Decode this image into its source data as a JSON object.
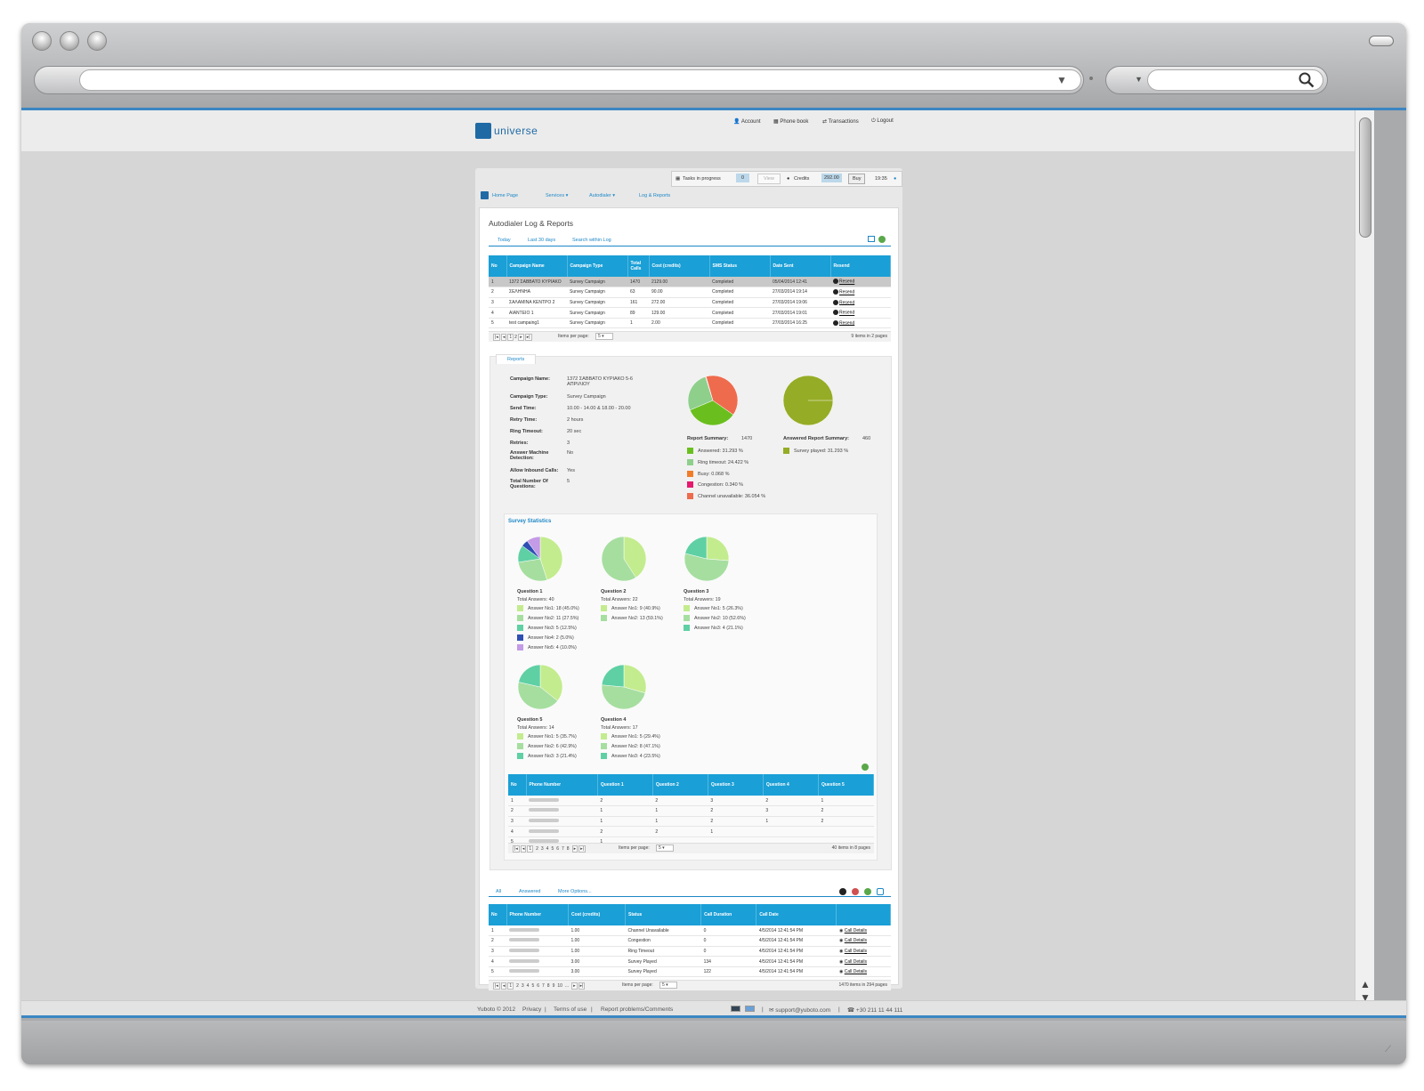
{
  "header": {
    "logo_text": "universe",
    "nav": [
      "Account",
      "Phone book",
      "Transactions",
      "Logout"
    ]
  },
  "statusbar": {
    "tasks_label": "Tasks in progress",
    "tasks_count": "0",
    "view_label": "View",
    "credits_label": "Credits",
    "credits_value": "292.00",
    "buy_label": "Buy",
    "time": "19:35"
  },
  "breadcrumbs": [
    "Home Page",
    "Services ▾",
    "Autodialer ▾",
    "Log & Reports"
  ],
  "page": {
    "title": "Autodialer Log & Reports",
    "tabs": [
      "Today",
      "Last 30 days",
      "Search within Log"
    ]
  },
  "campaigns": {
    "columns": [
      "No",
      "Campaign Name",
      "Campaign Type",
      "Total Calls",
      "Cost (credits)",
      "SMS Status",
      "Date Sent",
      "Resend"
    ],
    "rows": [
      [
        "1",
        "1372 ΣΑΒΒΑΤΟ ΚΥΡΙΑΚΟ",
        "Survey Campaign",
        "1470",
        "2129.00",
        "Completed",
        "05/04/2014 12:41",
        "Resend"
      ],
      [
        "2",
        "ΣΕΛΗΝΗΑ",
        "Survey Campaign",
        "63",
        "90.00",
        "Completed",
        "27/03/2014 19:14",
        "Resend"
      ],
      [
        "3",
        "ΣΑΛΑΜΙΝΑ ΚΕΝΤΡΟ 2",
        "Survey Campaign",
        "161",
        "272.00",
        "Completed",
        "27/03/2014 19:06",
        "Resend"
      ],
      [
        "4",
        "ΑΙΑΝΤΕΙΟ 1",
        "Survey Campaign",
        "89",
        "129.00",
        "Completed",
        "27/03/2014 19:01",
        "Resend"
      ],
      [
        "5",
        "test campaing1",
        "Survey Campaign",
        "1",
        "2.00",
        "Completed",
        "27/03/2014 16:25",
        "Resend"
      ]
    ],
    "pager": {
      "pages": [
        "1",
        "2"
      ],
      "items_per_page_label": "Items per page:",
      "items_per_page": "5",
      "summary": "9 items in 2 pages"
    }
  },
  "reports": {
    "tab": "Reports",
    "fields": [
      {
        "label": "Campaign Name:",
        "value": "1372 ΣΑΒΒΑΤΟ ΚΥΡΙΑΚΟ 5-6 ΑΠΡΙΛΙΟΥ"
      },
      {
        "label": "Campaign Type:",
        "value": "Survey Campaign"
      },
      {
        "label": "Send Time:",
        "value": "10.00 - 14.00 & 18.00 - 20.00"
      },
      {
        "label": "Retry Time:",
        "value": "2 hours"
      },
      {
        "label": "Ring Timeout:",
        "value": "20 sec"
      },
      {
        "label": "Retries:",
        "value": "3"
      },
      {
        "label": "Answer Machine Detection:",
        "value": "No"
      },
      {
        "label": "Allow Inbound Calls:",
        "value": "Yes"
      },
      {
        "label": "Total Number Of Questions:",
        "value": "5"
      }
    ],
    "summary": {
      "title": "Report Summary:",
      "total": "1470",
      "items": [
        {
          "label": "Answered: 31.293 %",
          "value": 31.293,
          "color": "#6abf1f"
        },
        {
          "label": "Ring timeout: 24.422 %",
          "value": 24.422,
          "color": "#8fcf8c"
        },
        {
          "label": "Busy: 0.068 %",
          "value": 0.068,
          "color": "#f07c2a"
        },
        {
          "label": "Congestion: 0.340 %",
          "value": 0.34,
          "color": "#e6196e"
        },
        {
          "label": "Channel unavailable: 36.054 %",
          "value": 36.054,
          "color": "#ef6b4d"
        }
      ]
    },
    "answered_summary": {
      "title": "Answered Report Summary:",
      "total": "460",
      "items": [
        {
          "label": "Survey played: 31.293 %",
          "value": 100,
          "color": "#95ac26"
        }
      ]
    }
  },
  "survey": {
    "title": "Survey Statistics",
    "questions": [
      {
        "title": "Question 1",
        "total": "Total Answers: 40",
        "answers": [
          {
            "label": "Answer No1: 18 (45.0%)",
            "value": 18,
            "color": "#c3ec8e"
          },
          {
            "label": "Answer No2: 11 (27.5%)",
            "value": 11,
            "color": "#a6dea0"
          },
          {
            "label": "Answer No3: 5 (12.5%)",
            "value": 5,
            "color": "#5fd0a4"
          },
          {
            "label": "Answer No4: 2 (5.0%)",
            "value": 2,
            "color": "#2f4fb3"
          },
          {
            "label": "Answer No5: 4 (10.0%)",
            "value": 4,
            "color": "#c49be6"
          }
        ]
      },
      {
        "title": "Question 2",
        "total": "Total Answers: 22",
        "answers": [
          {
            "label": "Answer No1: 9 (40.9%)",
            "value": 9,
            "color": "#c3ec8e"
          },
          {
            "label": "Answer No2: 13 (59.1%)",
            "value": 13,
            "color": "#a6dea0"
          }
        ]
      },
      {
        "title": "Question 3",
        "total": "Total Answers: 19",
        "answers": [
          {
            "label": "Answer No1: 5 (26.3%)",
            "value": 5,
            "color": "#c3ec8e"
          },
          {
            "label": "Answer No2: 10 (52.6%)",
            "value": 10,
            "color": "#a6dea0"
          },
          {
            "label": "Answer No3: 4 (21.1%)",
            "value": 4,
            "color": "#5fd0a4"
          }
        ]
      },
      {
        "title": "Question 5",
        "total": "Total Answers: 14",
        "answers": [
          {
            "label": "Answer No1: 5 (35.7%)",
            "value": 5,
            "color": "#c3ec8e"
          },
          {
            "label": "Answer No2: 6 (42.9%)",
            "value": 6,
            "color": "#a6dea0"
          },
          {
            "label": "Answer No3: 3 (21.4%)",
            "value": 3,
            "color": "#5fd0a4"
          }
        ]
      },
      {
        "title": "Question 4",
        "total": "Total Answers: 17",
        "answers": [
          {
            "label": "Answer No1: 5 (29.4%)",
            "value": 5,
            "color": "#c3ec8e"
          },
          {
            "label": "Answer No2: 8 (47.1%)",
            "value": 8,
            "color": "#a6dea0"
          },
          {
            "label": "Answer No3: 4 (23.5%)",
            "value": 4,
            "color": "#5fd0a4"
          }
        ]
      }
    ],
    "table": {
      "columns": [
        "No",
        "Phone Number",
        "Question 1",
        "Question 2",
        "Question 3",
        "Question 4",
        "Question 5"
      ],
      "rows": [
        [
          "1",
          "",
          "2",
          "2",
          "3",
          "2",
          "1"
        ],
        [
          "2",
          "",
          "1",
          "1",
          "2",
          "3",
          "2"
        ],
        [
          "3",
          "",
          "1",
          "1",
          "2",
          "1",
          "2"
        ],
        [
          "4",
          "",
          "2",
          "2",
          "1",
          "",
          ""
        ],
        [
          "5",
          "",
          "1",
          "",
          "",
          "",
          ""
        ]
      ],
      "pager": {
        "pages": [
          "1",
          "2",
          "3",
          "4",
          "5",
          "6",
          "7",
          "8"
        ],
        "items_per_page_label": "Items per page:",
        "items_per_page": "5",
        "summary": "40 items in 8 pages"
      }
    }
  },
  "calls": {
    "tabs": [
      "All",
      "Answered",
      "More Options..."
    ],
    "columns": [
      "No",
      "Phone Number",
      "Cost (credits)",
      "Status",
      "Call Duration",
      "Call Date",
      ""
    ],
    "rows": [
      [
        "1",
        "",
        "1.00",
        "Channel Unavailable",
        "0",
        "4/5/2014 12:41:54 PM",
        "Call Details"
      ],
      [
        "2",
        "",
        "1.00",
        "Congestion",
        "0",
        "4/5/2014 12:41:54 PM",
        "Call Details"
      ],
      [
        "3",
        "",
        "1.00",
        "Ring Timeout",
        "0",
        "4/5/2014 12:41:54 PM",
        "Call Details"
      ],
      [
        "4",
        "",
        "3.00",
        "Survey Played",
        "134",
        "4/5/2014 12:41:54 PM",
        "Call Details"
      ],
      [
        "5",
        "",
        "3.00",
        "Survey Played",
        "122",
        "4/5/2014 12:41:54 PM",
        "Call Details"
      ]
    ],
    "pager": {
      "pages": [
        "1",
        "2",
        "3",
        "4",
        "5",
        "6",
        "7",
        "8",
        "9",
        "10",
        "..."
      ],
      "items_per_page_label": "Items per page:",
      "items_per_page": "5",
      "summary": "1470 items in 294 pages"
    }
  },
  "footer": {
    "copyright": "Yuboto © 2012",
    "links": [
      "Privacy",
      "Terms of use",
      "Report problems/Comments"
    ],
    "email": "support@yuboto.com",
    "phone": "+30 211 11 44 111"
  }
}
